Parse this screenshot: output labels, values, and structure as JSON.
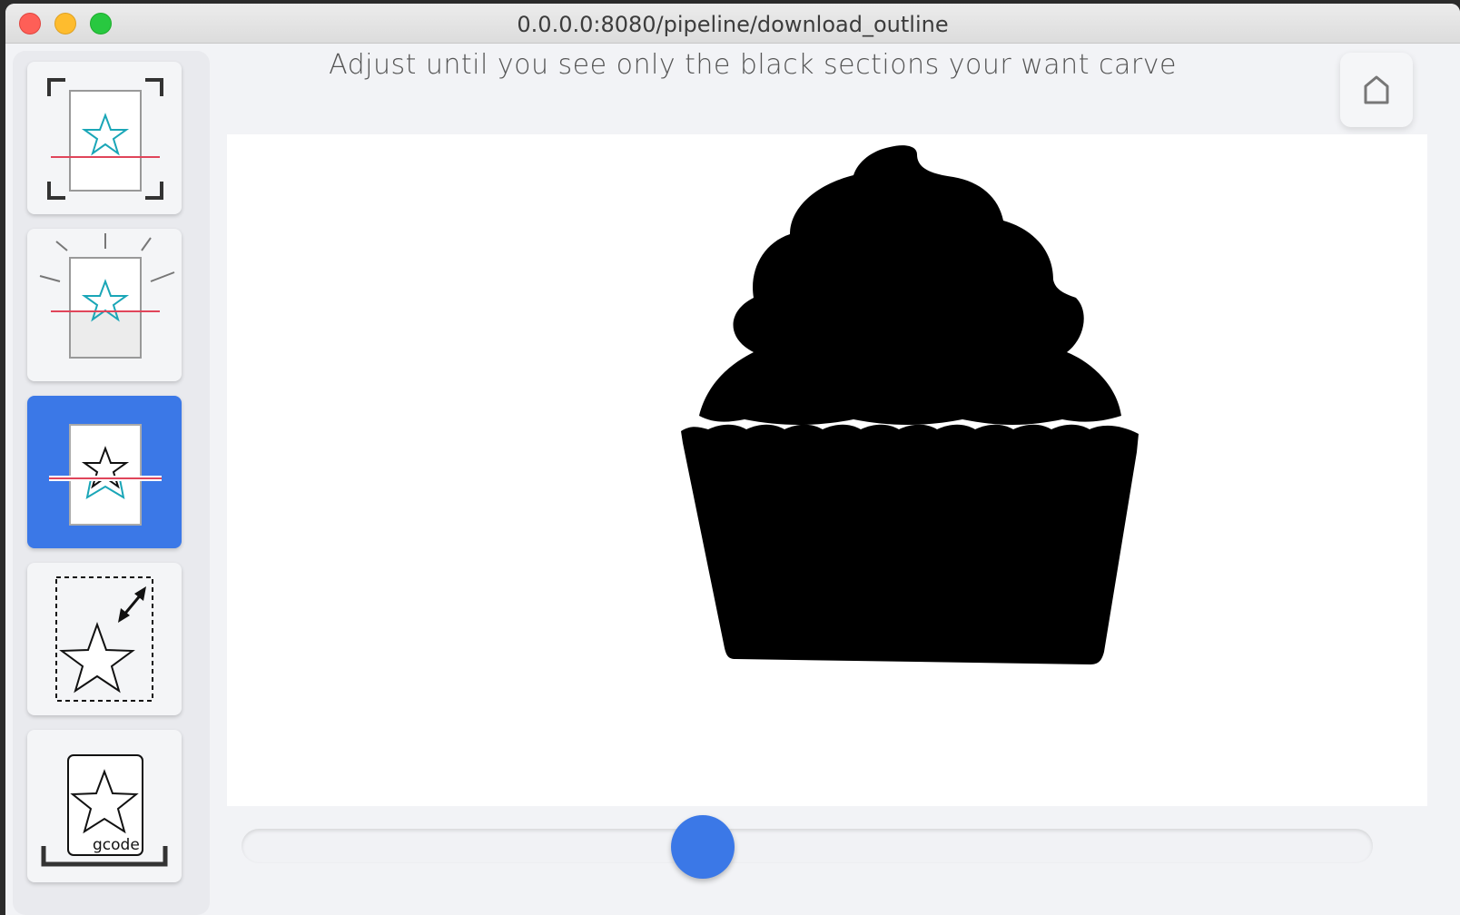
{
  "window": {
    "url": "0.0.0.0:8080/pipeline/download_outline"
  },
  "main": {
    "prompt": "Adjust until you see only the black sections your want carve",
    "home_icon": "home-icon",
    "preview_image": "cupcake-silhouette"
  },
  "sidebar": {
    "steps": [
      {
        "icon": "scan-frame-icon",
        "active": false
      },
      {
        "icon": "light-capture-icon",
        "active": false
      },
      {
        "icon": "threshold-icon",
        "active": true
      },
      {
        "icon": "resize-icon",
        "active": false
      },
      {
        "icon": "gcode-download-icon",
        "active": false,
        "label": "gcode"
      }
    ]
  },
  "threshold": {
    "value": 0.408
  },
  "colors": {
    "accent": "#3b78e7",
    "star_stroke": "#1aa6b7",
    "scan_line": "#e0455a"
  }
}
